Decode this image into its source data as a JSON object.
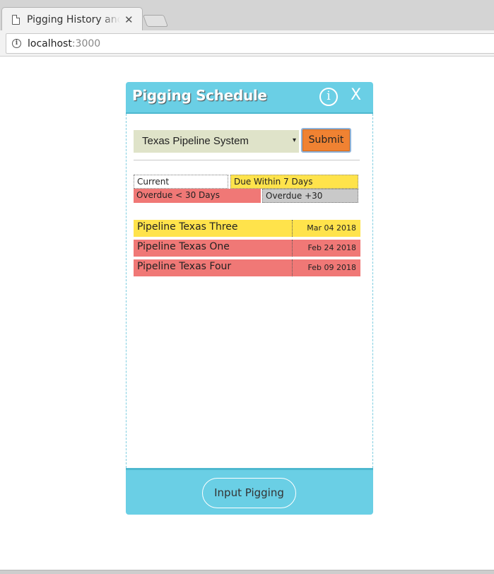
{
  "browser": {
    "tab_title": "Pigging History and Schedule",
    "url_host": "localhost",
    "url_port": ":3000"
  },
  "panel": {
    "title": "Pigging Schedule",
    "info_glyph": "i",
    "close_label": "X",
    "system_select": {
      "selected": "Texas Pipeline System",
      "arrow": "▾"
    },
    "submit_label": "Submit",
    "legend": {
      "current": "Current",
      "due_within_7": "Due Within 7 Days",
      "overdue_lt_30": "Overdue < 30 Days",
      "overdue_30_plus": "Overdue +30"
    },
    "rows": [
      {
        "name": "Pipeline Texas Three",
        "date": "Mar 04 2018",
        "status": "due",
        "color": "#ffe34b"
      },
      {
        "name": "Pipeline Texas One",
        "date": "Feb 24 2018",
        "status": "overdue",
        "color": "#f07876"
      },
      {
        "name": "Pipeline Texas Four",
        "date": "Feb 09 2018",
        "status": "overdue",
        "color": "#f07876"
      }
    ],
    "footer_button": "Input Pigging"
  },
  "colors": {
    "header": "#6acfe5",
    "submit": "#f08232",
    "due": "#ffe34b",
    "overdue": "#f07876",
    "overdue_30": "#c9c9c9"
  }
}
